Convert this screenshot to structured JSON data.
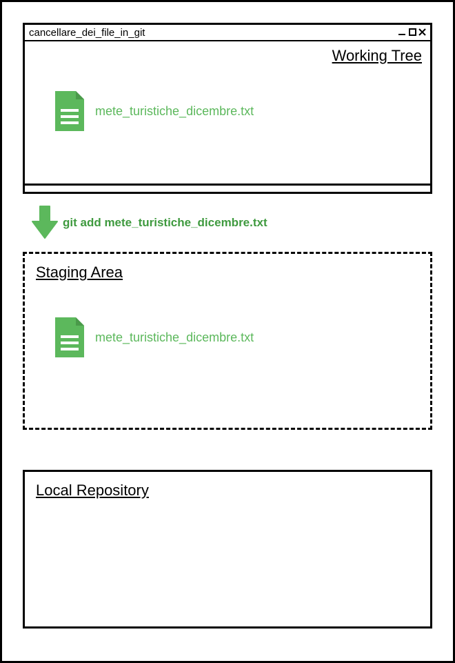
{
  "window": {
    "title": "cancellare_dei_file_in_git",
    "controls": "_ ▫ ✕"
  },
  "working_tree": {
    "title": "Working Tree",
    "file_name": "mete_turistiche_dicembre.txt"
  },
  "arrow": {
    "command": "git add mete_turistiche_dicembre.txt"
  },
  "staging": {
    "title": "Staging Area",
    "file_name": "mete_turistiche_dicembre.txt"
  },
  "repo": {
    "title": "Local Repository"
  },
  "colors": {
    "accent_green": "#5cb85c",
    "dark_green": "#3f9a3f"
  }
}
